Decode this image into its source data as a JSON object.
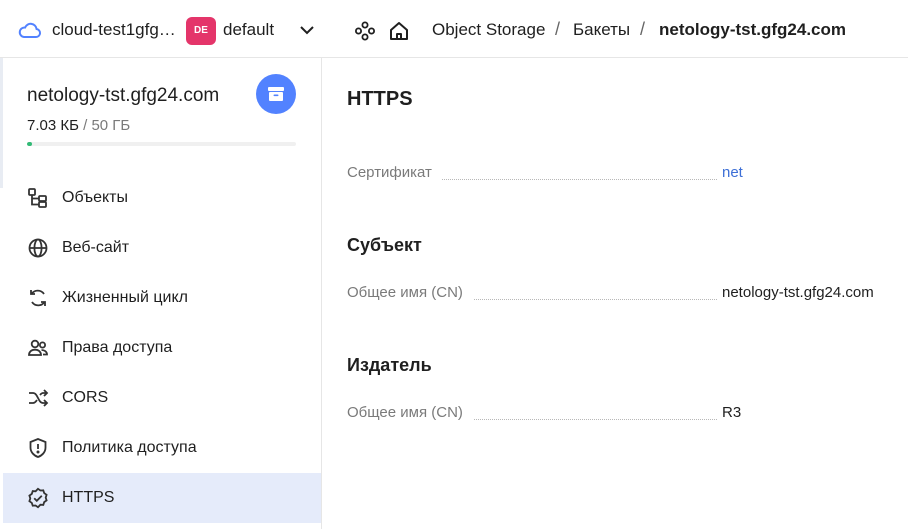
{
  "topbar": {
    "cloud_name": "cloud-test1gfg…",
    "folder_badge": "DE",
    "folder_name": "default",
    "breadcrumbs": [
      {
        "label": "Object Storage"
      },
      {
        "label": "Бакеты"
      },
      {
        "label": "netology-tst.gfg24.com"
      }
    ],
    "separator": "/"
  },
  "sidebar": {
    "bucket_name": "netology-tst.gfg24.com",
    "usage_used": "7.03 КБ",
    "usage_limit": "/ 50 ГБ",
    "usage_fraction": 0.0001,
    "items": [
      {
        "label": "Объекты",
        "icon": "objects-icon"
      },
      {
        "label": "Веб-сайт",
        "icon": "globe-icon"
      },
      {
        "label": "Жизненный цикл",
        "icon": "lifecycle-icon"
      },
      {
        "label": "Права доступа",
        "icon": "users-icon"
      },
      {
        "label": "CORS",
        "icon": "shuffle-icon"
      },
      {
        "label": "Политика доступа",
        "icon": "shield-icon"
      },
      {
        "label": "HTTPS",
        "icon": "badge-check-icon"
      }
    ],
    "active_index": 6
  },
  "main": {
    "title": "HTTPS",
    "certificate": {
      "key": "Сертификат",
      "value": "net"
    },
    "subject": {
      "title": "Субъект",
      "key": "Общее имя (CN)",
      "value": "netology-tst.gfg24.com"
    },
    "issuer": {
      "title": "Издатель",
      "key": "Общее имя (CN)",
      "value": "R3"
    }
  },
  "colors": {
    "accent": "#5282ff",
    "active_item": "#e5ebfa",
    "link": "#3d6fd6",
    "folder_badge": "#e4356a",
    "usage_fill": "#32ba76"
  }
}
